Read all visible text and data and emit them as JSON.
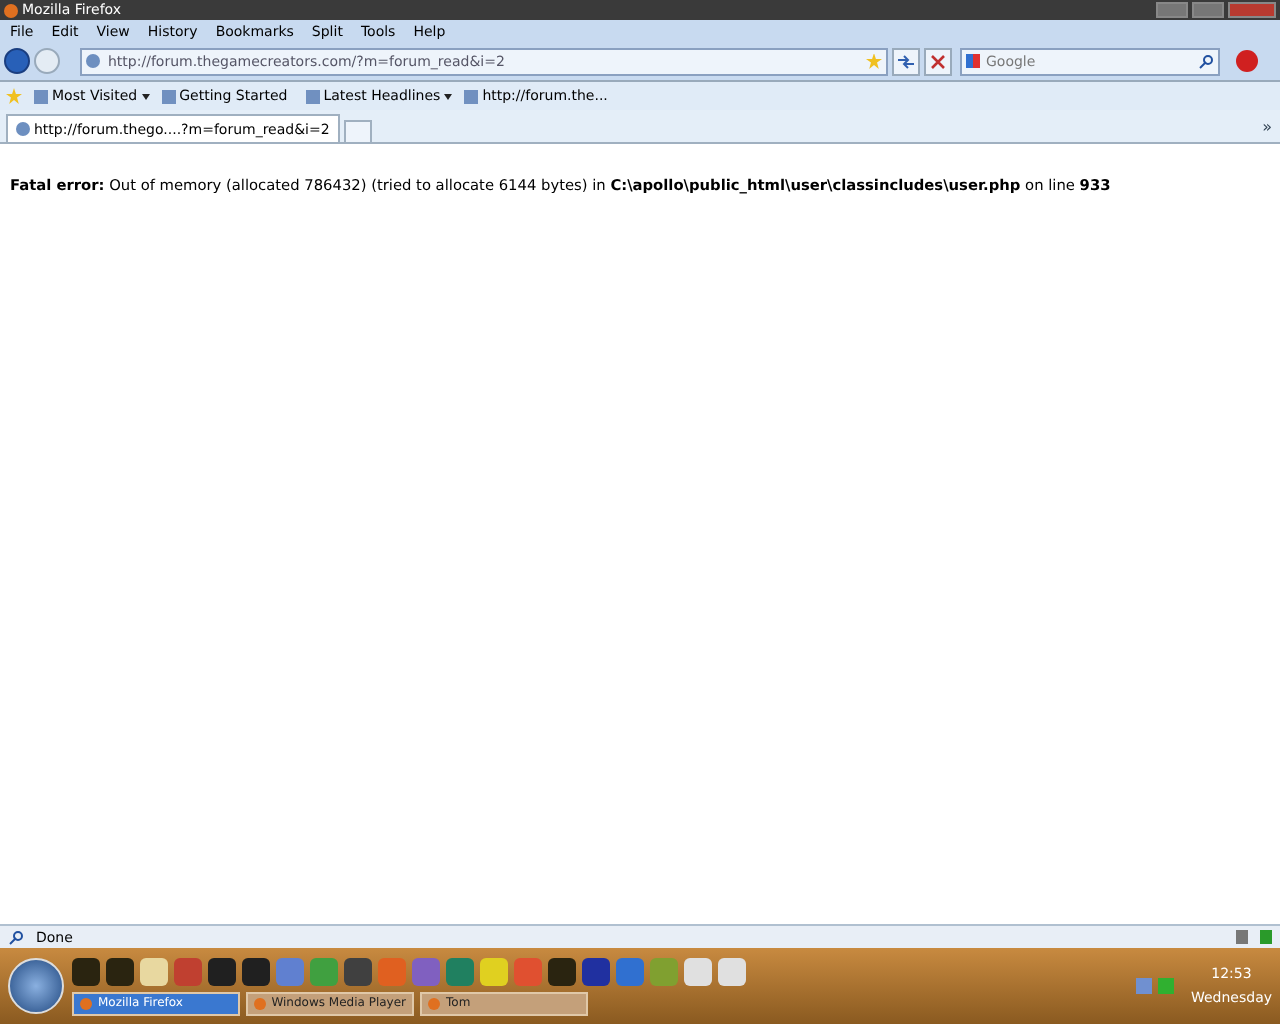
{
  "window": {
    "title": "Mozilla Firefox"
  },
  "menu": [
    "File",
    "Edit",
    "View",
    "History",
    "Bookmarks",
    "Split",
    "Tools",
    "Help"
  ],
  "address": {
    "value": "http://forum.thegamecreators.com/?m=forum_read&i=2"
  },
  "search": {
    "placeholder": "Google"
  },
  "bookmarks": [
    {
      "label": "Most Visited",
      "dropdown": true
    },
    {
      "label": "Getting Started",
      "dropdown": false
    },
    {
      "label": "Latest Headlines",
      "dropdown": true
    },
    {
      "label": "http://forum.the...",
      "dropdown": false
    }
  ],
  "overflow": "»",
  "tabs": [
    {
      "label": "http://forum.thego....?m=forum_read&i=2",
      "selected": true
    }
  ],
  "content": {
    "message": "**Fatal error:** Out of memory (allocated 786432) (tried to allocate 6144 bytes) in **C:\\apollo\\public_html\\user\\classincludes\\user.php** on line **933**"
  },
  "status_bar": {
    "text": "Done"
  },
  "taskbar": {
    "tasks": [
      {
        "label": "Mozilla Firefox",
        "selected": true
      },
      {
        "label": "Windows Media Player",
        "selected": false
      },
      {
        "label": "Tom",
        "selected": false
      }
    ],
    "clock": {
      "time": "12:53",
      "day": "Wednesday"
    }
  }
}
